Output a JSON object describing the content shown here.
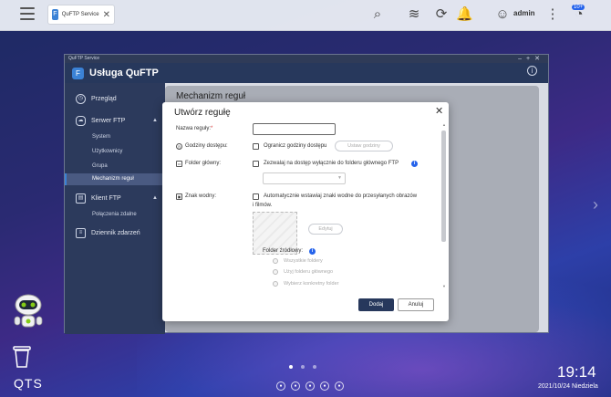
{
  "taskbar": {
    "tab_label": "QuFTP Service",
    "user": "admin",
    "notification_count": "10+"
  },
  "window": {
    "titlebar_text": "QuFTP Service",
    "app_title": "Usługa QuFTP",
    "panel_title": "Mechanizm reguł"
  },
  "sidebar": {
    "overview": "Przegląd",
    "ftp_server": "Serwer FTP",
    "system": "System",
    "users": "Użytkownicy",
    "group": "Grupa",
    "rules": "Mechanizm reguł",
    "ftp_client": "Klient FTP",
    "remote_connections": "Połączenia zdalne",
    "event_log": "Dziennik zdarzeń"
  },
  "modal": {
    "title": "Utwórz regułę",
    "rule_name_label": "Nazwa reguły:",
    "required_mark": "*",
    "rule_name_value": "",
    "access_hours_label": "Godziny dostępu:",
    "limit_hours_text": "Ogranicz godziny dostępu",
    "set_hours_button": "Ustaw godziny",
    "home_folder_label": "Folder główny:",
    "restrict_folder_text": "Zezwalaj na dostęp wyłącznie do folderu głównego FTP",
    "folder_select_value": "",
    "watermark_label": "Znak wodny:",
    "watermark_text_line1": "Automatycznie wstawiaj znaki wodne do przesyłanych obrazów",
    "watermark_text_line2": "i filmów.",
    "edit_button": "Edytuj",
    "source_folder_label": "Folder źródłowy:",
    "radio_all": "Wszystkie foldery",
    "radio_home": "Użyj folderu głównego",
    "radio_specific": "Wybierz konkretny folder",
    "ok_button": "Dodaj",
    "cancel_button": "Anuluj"
  },
  "desktop": {
    "brand": "QTS",
    "time": "19:14",
    "date": "2021/10/24 Niedziela"
  },
  "colors": {
    "accent": "#2563eb",
    "primary_dark": "#27385c"
  }
}
